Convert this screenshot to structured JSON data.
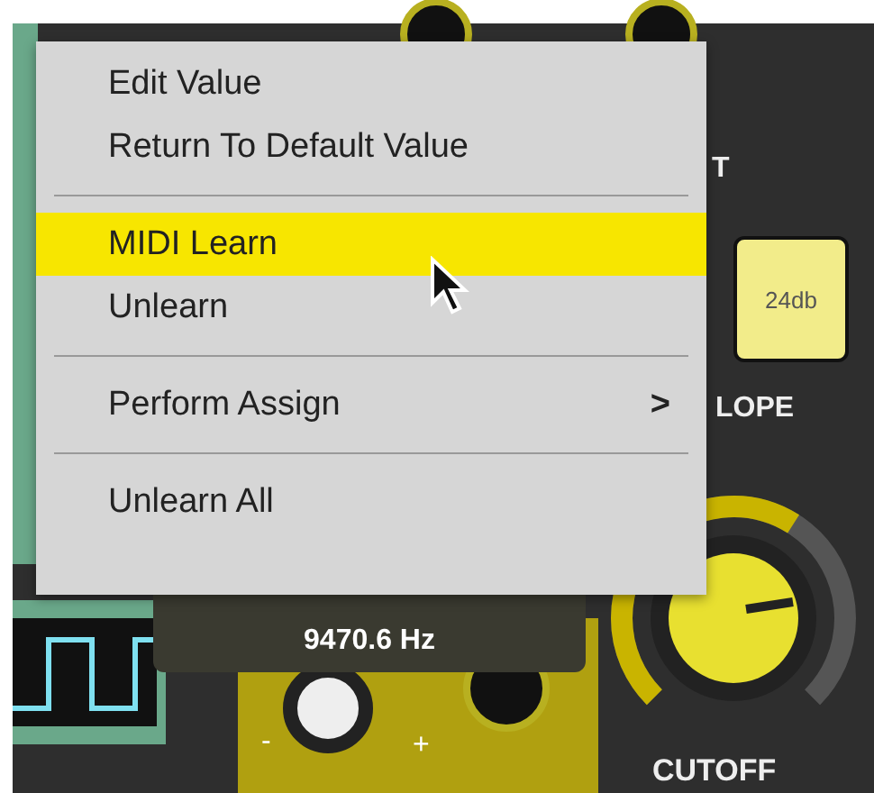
{
  "panel": {
    "top_label": "T",
    "slope_button": {
      "label": "24db",
      "on": true
    },
    "slope_label": "LOPE",
    "tooltip": {
      "value": "9470.6 Hz"
    },
    "mod_knob": {
      "minus": "-",
      "plus": "+"
    },
    "cutoff": {
      "label": "CUTOFF"
    }
  },
  "menu": {
    "items": [
      {
        "kind": "item",
        "label": "Edit Value",
        "selected": false
      },
      {
        "kind": "item",
        "label": "Return To Default Value",
        "selected": false
      },
      {
        "kind": "separator"
      },
      {
        "kind": "item",
        "label": "MIDI Learn",
        "selected": true
      },
      {
        "kind": "item",
        "label": "Unlearn",
        "selected": false
      },
      {
        "kind": "separator"
      },
      {
        "kind": "submenu",
        "label": "Perform Assign",
        "arrow": ">",
        "selected": false
      },
      {
        "kind": "separator"
      },
      {
        "kind": "item",
        "label": "Unlearn All",
        "selected": false
      }
    ]
  }
}
